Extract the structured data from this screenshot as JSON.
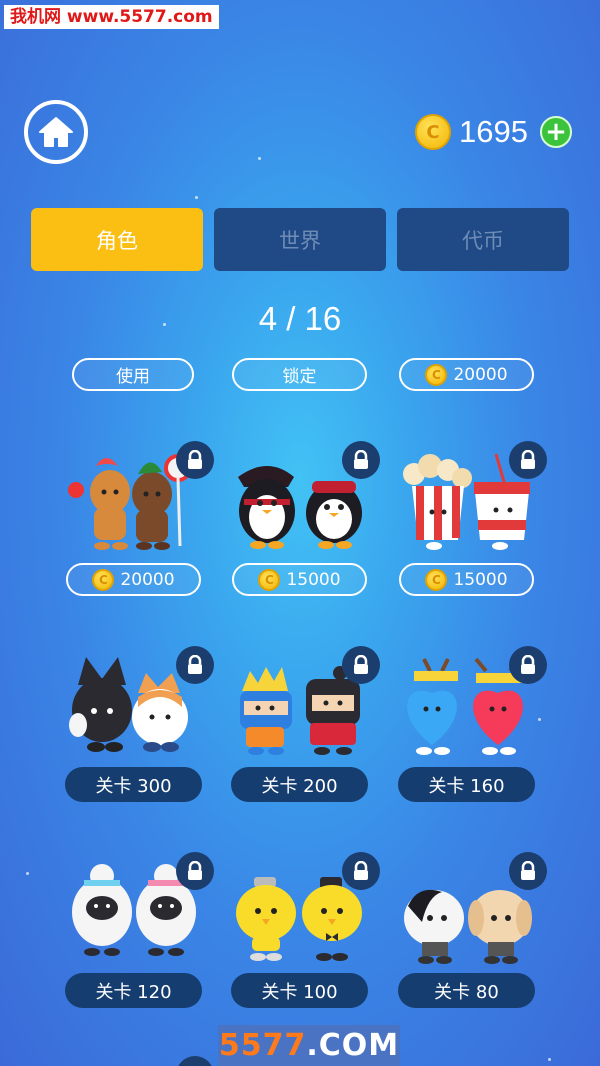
{
  "watermark_top": "我机网 www.5577.com",
  "balance": {
    "coin_symbol": "C",
    "amount": "1695"
  },
  "tabs": [
    {
      "label": "角色",
      "active": true
    },
    {
      "label": "世界",
      "active": false
    },
    {
      "label": "代币",
      "active": false
    }
  ],
  "page_indicator": "4 / 16",
  "top_row": [
    {
      "label": "使用",
      "has_coin": false
    },
    {
      "label": "锁定",
      "has_coin": false
    },
    {
      "label": "20000",
      "has_coin": true
    }
  ],
  "grid": [
    {
      "character": "gingerbread-pair",
      "price": "20000",
      "has_coin": true,
      "locked": true
    },
    {
      "character": "pirate-penguin-pair",
      "price": "15000",
      "has_coin": true,
      "locked": true
    },
    {
      "character": "popcorn-soda-pair",
      "price": "15000",
      "has_coin": true,
      "locked": true
    },
    {
      "character": "fox-cat-pair",
      "price": "关卡 300",
      "has_coin": false,
      "locked": true
    },
    {
      "character": "ninja-pair",
      "price": "关卡 200",
      "has_coin": false,
      "locked": true
    },
    {
      "character": "heart-reindeer-pair",
      "price": "关卡 160",
      "has_coin": false,
      "locked": true
    },
    {
      "character": "sheep-pair",
      "price": "关卡 120",
      "has_coin": false,
      "locked": true
    },
    {
      "character": "chick-pair",
      "price": "关卡 100",
      "has_coin": false,
      "locked": true
    },
    {
      "character": "dog-pair",
      "price": "关卡 80",
      "has_coin": false,
      "locked": true
    }
  ],
  "watermark_bottom": {
    "part1": "5577",
    "part2": ".COM"
  },
  "colors": {
    "accent": "#fbbf14",
    "tab_inactive": "#1f4a85",
    "pill_dark": "#153d6f",
    "plus": "#3bc33b"
  }
}
